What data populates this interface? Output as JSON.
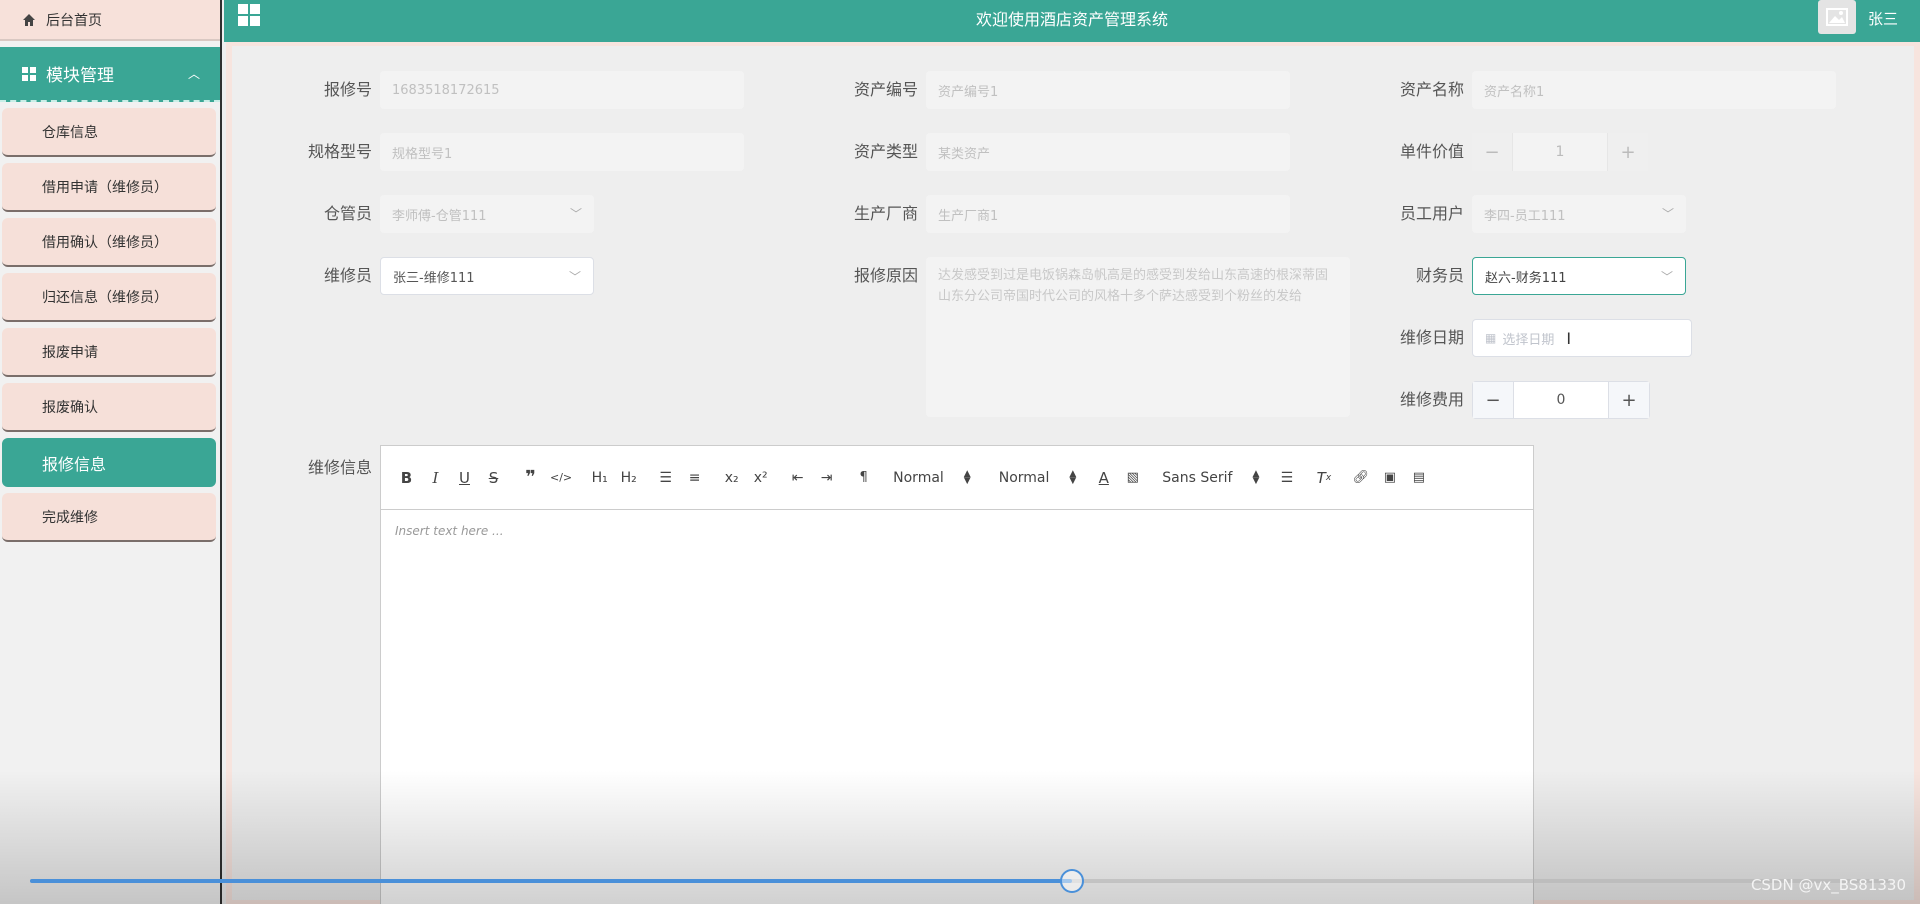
{
  "sidebar": {
    "home": "后台首页",
    "group": "模块管理",
    "items": [
      {
        "label": "仓库信息",
        "active": false
      },
      {
        "label": "借用申请（维修员）",
        "active": false
      },
      {
        "label": "借用确认（维修员）",
        "active": false
      },
      {
        "label": "归还信息（维修员）",
        "active": false
      },
      {
        "label": "报废申请",
        "active": false
      },
      {
        "label": "报废确认",
        "active": false
      },
      {
        "label": "报修信息",
        "active": true
      },
      {
        "label": "完成维修",
        "active": false
      }
    ]
  },
  "header": {
    "title": "欢迎使用酒店资产管理系统",
    "username": "张三"
  },
  "form": {
    "repair_no": {
      "label": "报修号",
      "value": "1683518172615"
    },
    "asset_no": {
      "label": "资产编号",
      "value": "资产编号1"
    },
    "asset_name": {
      "label": "资产名称",
      "value": "资产名称1"
    },
    "spec": {
      "label": "规格型号",
      "value": "规格型号1"
    },
    "asset_type": {
      "label": "资产类型",
      "value": "某类资产"
    },
    "unit_value": {
      "label": "单件价值",
      "value": "1",
      "minus": "−",
      "plus": "+"
    },
    "keeper": {
      "label": "仓管员",
      "value": "李师傅-仓管111"
    },
    "manufacturer": {
      "label": "生产厂商",
      "value": "生产厂商1"
    },
    "employee": {
      "label": "员工用户",
      "value": "李四-员工111"
    },
    "repairer": {
      "label": "维修员",
      "value": "张三-维修111"
    },
    "reason": {
      "label": "报修原因",
      "value": "达发感受到过是电饭锅森岛帆高是的感受到发给山东高速的根深蒂固山东分公司帝国时代公司的风格十多个萨达感受到个粉丝的发给"
    },
    "finance": {
      "label": "财务员",
      "value": "赵六-财务111"
    },
    "repair_date": {
      "label": "维修日期",
      "placeholder": "选择日期"
    },
    "repair_cost": {
      "label": "维修费用",
      "value": "0",
      "minus": "−",
      "plus": "+"
    },
    "repair_info": {
      "label": "维修信息"
    }
  },
  "editor": {
    "header_select": "Normal",
    "size_select": "Normal",
    "font_select": "Sans Serif",
    "placeholder": "Insert text here ..."
  },
  "video": {
    "progress": 0.56,
    "watermark": "CSDN @vx_BS81330"
  }
}
